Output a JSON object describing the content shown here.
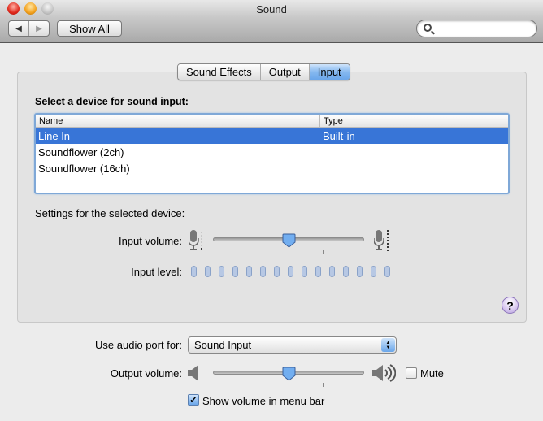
{
  "window": {
    "title": "Sound"
  },
  "toolbar": {
    "back_icon": "◀",
    "forward_icon": "▶",
    "show_all_label": "Show All",
    "search_placeholder": ""
  },
  "tabs": [
    {
      "label": "Sound Effects",
      "selected": false
    },
    {
      "label": "Output",
      "selected": false
    },
    {
      "label": "Input",
      "selected": true
    }
  ],
  "input_panel": {
    "heading": "Select a device for sound input:",
    "columns": [
      "Name",
      "Type"
    ],
    "devices": [
      {
        "name": "Line In",
        "type": "Built-in",
        "selected": true
      },
      {
        "name": "Soundflower (2ch)",
        "type": "",
        "selected": false
      },
      {
        "name": "Soundflower (16ch)",
        "type": "",
        "selected": false
      }
    ],
    "settings_label": "Settings for the selected device:",
    "input_volume_label": "Input volume:",
    "input_volume_value": 0.5,
    "input_level_label": "Input level:",
    "input_level_segments": 15,
    "input_level_active": 0
  },
  "help_label": "?",
  "bottom": {
    "audio_port_label": "Use audio port for:",
    "audio_port_value": "Sound Input",
    "output_volume_label": "Output volume:",
    "output_volume_value": 0.5,
    "mute_label": "Mute",
    "mute_checked": false,
    "show_volume_label": "Show volume in menu bar",
    "show_volume_checked": true,
    "checkmark": "✓"
  }
}
